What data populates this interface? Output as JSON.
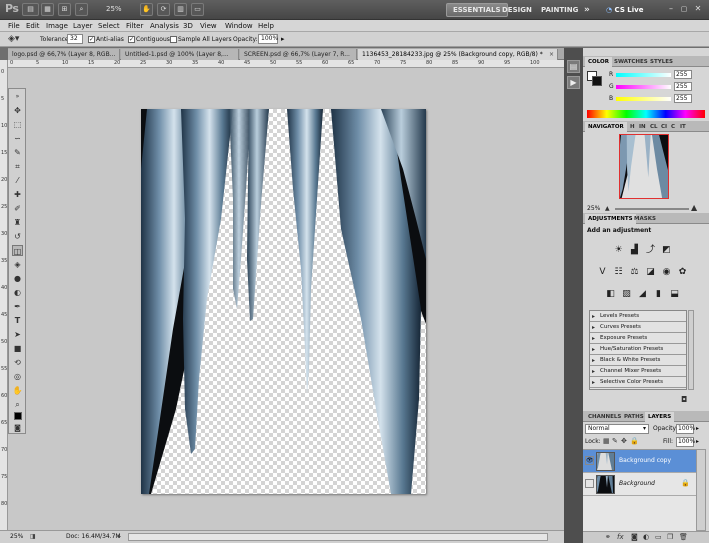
{
  "app": {
    "logo": "Ps",
    "zoom": "25%",
    "workspaces": [
      "ESSENTIALS",
      "DESIGN",
      "PAINTING"
    ],
    "more": "»",
    "cslive": "CS Live"
  },
  "menu": [
    "File",
    "Edit",
    "Image",
    "Layer",
    "Select",
    "Filter",
    "Analysis",
    "3D",
    "View",
    "Window",
    "Help"
  ],
  "options": {
    "tolerance_label": "Tolerance:",
    "tolerance_value": "32",
    "antialias_label": "Anti-alias",
    "contiguous_label": "Contiguous",
    "sample_all_label": "Sample All Layers",
    "opacity_label": "Opacity:",
    "opacity_value": "100%"
  },
  "doc_tabs": [
    {
      "label": "logo.psd @ 66,7% (Layer 8, RGB..."
    },
    {
      "label": "Untitled-1.psd @ 100% (Layer 8,..."
    },
    {
      "label": "SCREEN.psd @ 66,7% (Layer 7, R..."
    },
    {
      "label": "1136453_28184233.jpg @ 25% (Background copy, RGB/8) *"
    }
  ],
  "ruler_ticks": [
    "0",
    "5",
    "10",
    "15",
    "20",
    "25",
    "30",
    "35",
    "40",
    "45",
    "50",
    "55",
    "60",
    "65",
    "70",
    "75",
    "80",
    "85",
    "90",
    "95",
    "100"
  ],
  "status": {
    "zoom": "25%",
    "doc": "Doc: 16.4M/34.7M"
  },
  "color_panel": {
    "tabs": [
      "COLOR",
      "SWATCHES",
      "STYLES"
    ],
    "channels": [
      {
        "label": "R",
        "value": "255",
        "color": "#d04040"
      },
      {
        "label": "G",
        "value": "255",
        "color": "#40a040"
      },
      {
        "label": "B",
        "value": "255",
        "color": "#4060d0"
      }
    ]
  },
  "navigator": {
    "tabs": [
      "NAVIGATOR",
      "H",
      "IN",
      "CL",
      "CI",
      "C",
      "IT"
    ],
    "zoom": "25%"
  },
  "adjustments": {
    "tabs": [
      "ADJUSTMENTS",
      "MASKS"
    ],
    "heading": "Add an adjustment",
    "presets": [
      "Levels Presets",
      "Curves Presets",
      "Exposure Presets",
      "Hue/Saturation Presets",
      "Black & White Presets",
      "Channel Mixer Presets",
      "Selective Color Presets"
    ]
  },
  "layers_panel": {
    "tabs": [
      "CHANNELS",
      "PATHS",
      "LAYERS"
    ],
    "blend_mode": "Normal",
    "opacity_label": "Opacity:",
    "opacity_value": "100%",
    "lock_label": "Lock:",
    "fill_label": "Fill:",
    "fill_value": "100%",
    "layers": [
      {
        "name": "Background copy",
        "selected": true
      },
      {
        "name": "Background",
        "selected": false
      }
    ]
  },
  "colors": {
    "accent": "#5b8fd6",
    "chrome": "#4b4b4b"
  }
}
